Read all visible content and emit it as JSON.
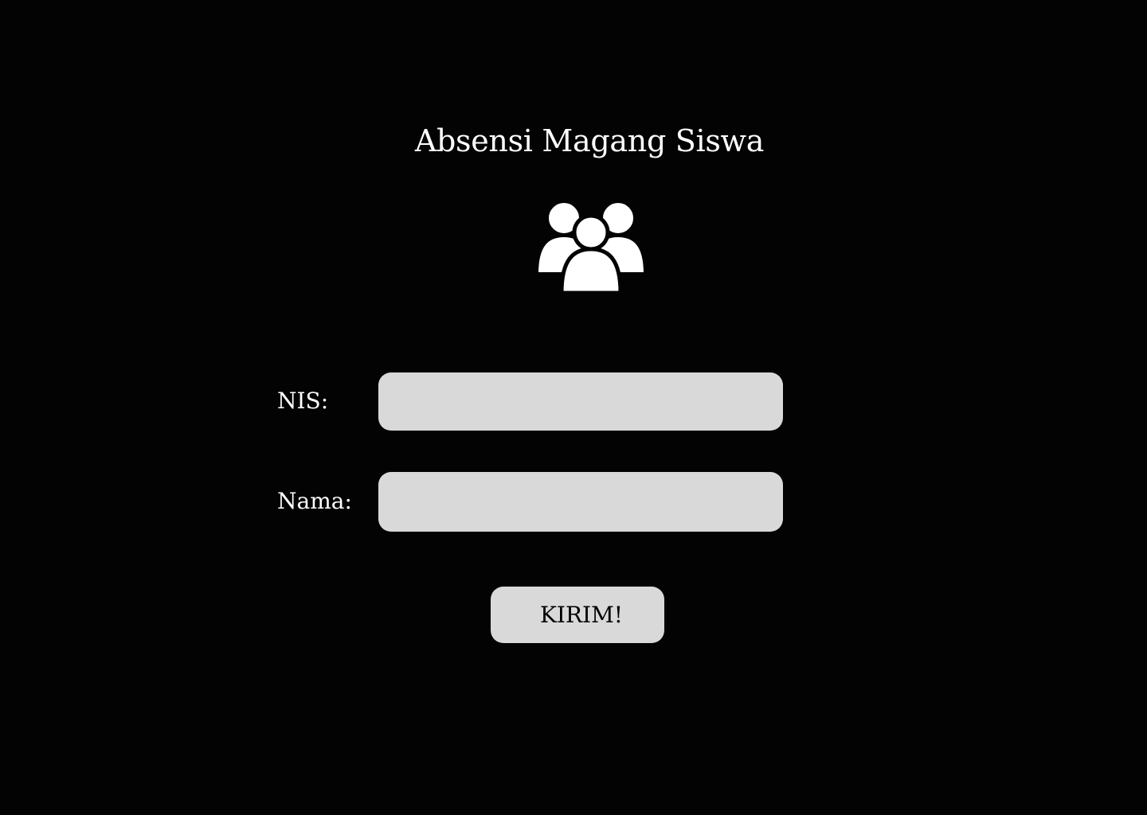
{
  "page": {
    "title": "Absensi Magang Siswa",
    "background_color": "#030303",
    "text_color": "#ffffff"
  },
  "header_icon": {
    "name": "people-group-icon",
    "color": "#ffffff"
  },
  "form": {
    "nis_label": "NIS:",
    "nis_value": "",
    "nama_label": "Nama:",
    "nama_value": "",
    "input_color": "#d9d9d9",
    "submit_label": "KIRIM!"
  }
}
